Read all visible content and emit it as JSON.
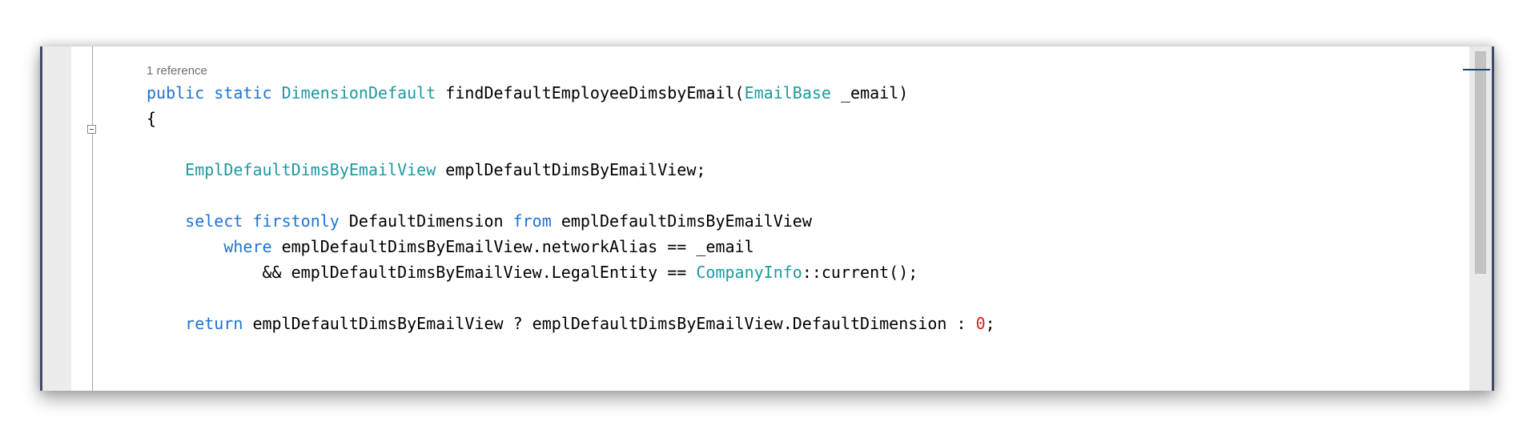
{
  "editor": {
    "reference_label": "1 reference",
    "lines": {
      "sig_public": "public",
      "sig_static": "static",
      "sig_return_type": "DimensionDefault",
      "sig_method": "findDefaultEmployeeDimsbyEmail(",
      "sig_param_type": "EmailBase",
      "sig_param": "_email)",
      "open_brace": "{",
      "decl_type": "EmplDefaultDimsByEmailView",
      "decl_var": "emplDefaultDimsByEmailView;",
      "sel_select": "select",
      "sel_firstonly": "firstonly",
      "sel_field": "DefaultDimension",
      "sel_from": "from",
      "sel_table": "emplDefaultDimsByEmailView",
      "where_kw": "where",
      "where_cond": "emplDefaultDimsByEmailView.networkAlias == _email",
      "and_cond": "&& emplDefaultDimsByEmailView.LegalEntity ==",
      "and_type": "CompanyInfo",
      "and_call": "::current();",
      "ret_kw": "return",
      "ret_expr": "emplDefaultDimsByEmailView ? emplDefaultDimsByEmailView.DefaultDimension :",
      "ret_zero": "0",
      "ret_end": ";"
    }
  },
  "icons": {
    "fold": "collapse-region-icon"
  },
  "colors": {
    "keyword": "#1e73d2",
    "type": "#1c9aa0",
    "number": "#e21b1b",
    "reference": "#6e6e6e",
    "frame_border": "#3f4a66"
  }
}
